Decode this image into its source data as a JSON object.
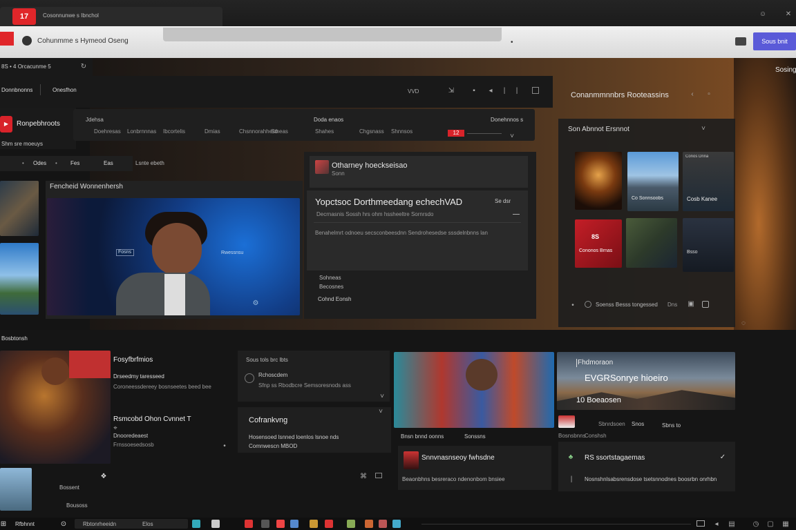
{
  "browser": {
    "tab_badge": "17",
    "tab_title": "Cosonnunwe s Ibnchol",
    "address_text": "Cohunmme s Hymeod Oseng",
    "address_dot": "•",
    "action_button": "Sous bnit"
  },
  "subbar": {
    "left_text": "8S  •  4  Orcacunme  5",
    "right_text": "Sosing"
  },
  "nav": {
    "tab1": "Donnbnonns",
    "tab2": "Onesfhon",
    "mid_label": "VVD"
  },
  "channel": {
    "name": "Ronpebhroots",
    "sub": "Shm sre moeuys"
  },
  "filter": {
    "items": [
      "Jdehsa",
      "Doehresas",
      "Lonbrnnnas",
      "Ibcortelis",
      "Dmias",
      "Chsnnorahheso",
      "Stheas",
      "Shahes",
      "Chgsnass",
      "Shnnsos"
    ],
    "title2": "Doda enaos",
    "right_label": "Donehnnos  s",
    "badge": "12"
  },
  "toolbar2": {
    "items": [
      "•",
      "Odes",
      "•",
      "Fes",
      "Eas"
    ],
    "right": "Lsnte ebeth"
  },
  "video": {
    "title": "Fencheid Wonnenhersh",
    "screen_tag": "Fosns",
    "screen_sub": "Rwessnsu"
  },
  "detail": {
    "header": "Otharney hoeckseisao",
    "header_sub": "Sonn",
    "title": "Yopctsoc Dorthmeedang echechVAD",
    "title_right": "Se  dsr",
    "line1": "Decrnasnis Sossh hrs ohm hssheeltre Sornrsdo",
    "line2": "Benahelmrt odnoeu secsconbeesdnn Sendrohesedse sssdelnbnns lan",
    "foot1": "Sohneas",
    "foot2": "Becosnes",
    "foot3": "Cohnd Eonsh"
  },
  "side": {
    "header": "Conanmmnnbrs Rooteassins",
    "panel_title": "Son Abnnot Ersnnot",
    "cells": [
      "",
      "Co Sonnsoobs",
      "Cosb Kanee",
      "Cononos Brnas",
      "",
      "Bsso"
    ],
    "cell1_top": "Conos Dnna",
    "cell_red_badge": "8S",
    "footer": "Soenss Besss tongessed",
    "footer_right": "Dns"
  },
  "section": {
    "title": "Bosbtonsh"
  },
  "feed": {
    "left_title": "Fosyfbrfmios",
    "left_line1": "Drseedmy taresseed",
    "left_line2": "Coroneessdereey bosnseetes beed bee",
    "card2_title": "Sous tols brc lbts",
    "card2_line1": "Rchoscdem",
    "card2_line2": "Sfnp ss Rbodbcre  Semsoresnods ass",
    "row2_title": "Rsmcobd Ohon Cvnnet  T",
    "row2_line1": "Dnooredeaest",
    "row2_line2": "Frnssoesedsosb",
    "card3_title": "Cofrankvng",
    "card3_line1": "Hosensoed lsnned loenlos lsnoe nds",
    "card3_line2": "Comnwescn MBOD",
    "thumb_caption1": "Bnsn bnnd oonns",
    "thumb_caption2": "Sonssns",
    "bottom_left": "Bossent",
    "bottom_left2": "Bousoss"
  },
  "right_feed": {
    "tag": "Fhdmoraon",
    "title": "EVGRSonrye hioeiro",
    "sub": "10 Boeaosen",
    "row": [
      "Sbnrdsoen",
      "Snos",
      "Sbns to",
      "Bosnsbnns",
      "Conshsh"
    ],
    "card_title": "Snnvnasnseoy fwhsdne",
    "card_sub": "Beaonbhns besreraco ndenonbom bnsiee",
    "card2_title": "RS ssortstagaemas",
    "card2_sub": "Nosnshnlsabsrensdose tsetsnnodnes boosrbn onrhbn"
  },
  "taskbar": {
    "start": "Rfbhnnt",
    "search": "Rbtonrheeidn",
    "mid": "Elos"
  }
}
